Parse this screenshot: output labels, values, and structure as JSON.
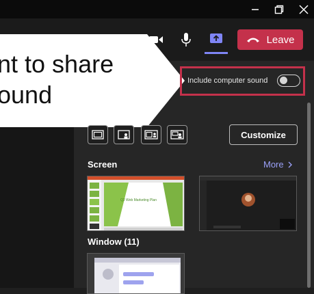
{
  "callout": {
    "line1": "nt to share",
    "line2": "ound"
  },
  "toolbar": {
    "leave_label": "Leave"
  },
  "sound": {
    "label": "Include computer sound",
    "enabled": false
  },
  "share": {
    "customize_label": "Customize",
    "screen_title": "Screen",
    "more_label": "More",
    "window_title": "Window (11)"
  },
  "slide": {
    "title": "Q2 Web Marketing Plan"
  },
  "colors": {
    "accent": "#7f85f5",
    "leave": "#c4314b",
    "highlight": "#c4314b"
  }
}
